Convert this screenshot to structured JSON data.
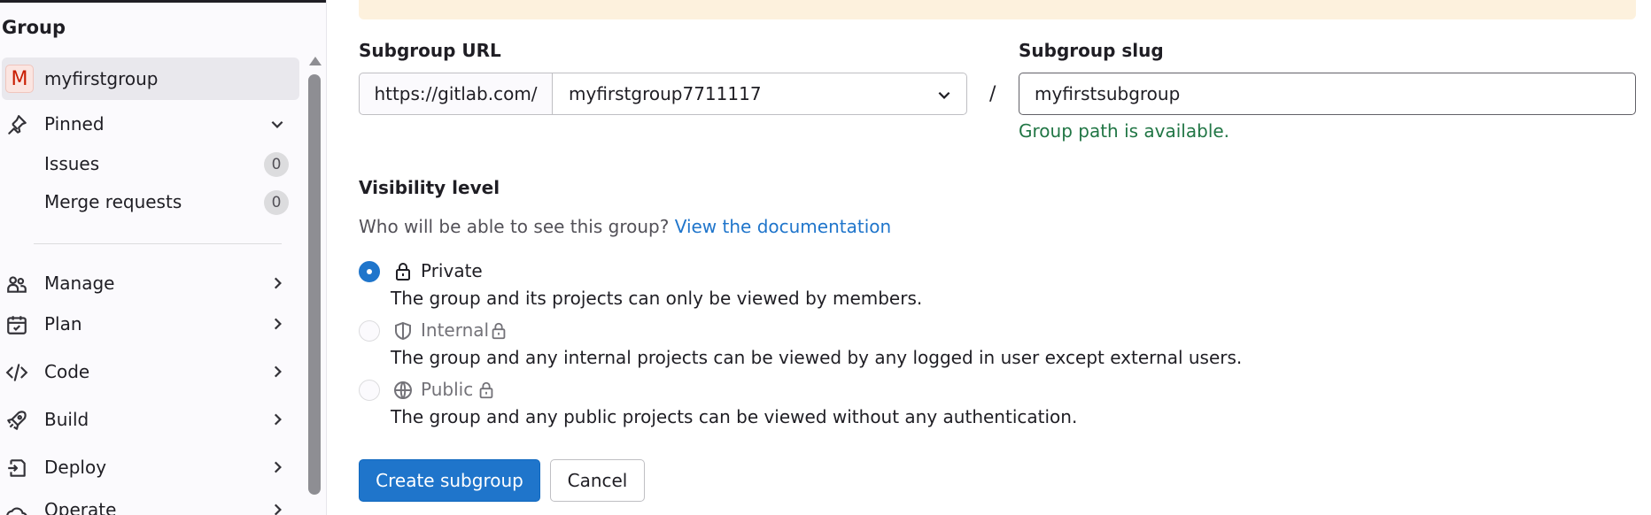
{
  "sidebar": {
    "title": "Group",
    "group": {
      "avatar_letter": "M",
      "name": "myfirstgroup"
    },
    "pinned": {
      "label": "Pinned",
      "items": [
        {
          "label": "Issues",
          "count": "0"
        },
        {
          "label": "Merge requests",
          "count": "0"
        }
      ]
    },
    "nav": [
      {
        "label": "Manage",
        "icon": "users-icon"
      },
      {
        "label": "Plan",
        "icon": "calendar-icon"
      },
      {
        "label": "Code",
        "icon": "code-icon"
      },
      {
        "label": "Build",
        "icon": "rocket-icon"
      },
      {
        "label": "Deploy",
        "icon": "deploy-icon"
      },
      {
        "label": "Operate",
        "icon": "cloud-icon"
      }
    ]
  },
  "form": {
    "url": {
      "label": "Subgroup URL",
      "prefix": "https://gitlab.com/",
      "selected_group": "myfirstgroup7711117"
    },
    "slug": {
      "label": "Subgroup slug",
      "value": "myfirstsubgroup",
      "status": "Group path is available."
    },
    "separator": "/",
    "visibility": {
      "label": "Visibility level",
      "help": "Who will be able to see this group?",
      "help_link": "View the documentation",
      "options": [
        {
          "label": "Private",
          "description": "The group and its projects can only be viewed by members.",
          "checked": true,
          "disabled": false
        },
        {
          "label": "Internal",
          "description": "The group and any internal projects can be viewed by any logged in user except external users.",
          "checked": false,
          "disabled": true
        },
        {
          "label": "Public",
          "description": "The group and any public projects can be viewed without any authentication.",
          "checked": false,
          "disabled": true
        }
      ]
    },
    "buttons": {
      "create": "Create subgroup",
      "cancel": "Cancel"
    }
  },
  "colors": {
    "primary": "#1f75cb",
    "success": "#217645",
    "alert_bg": "#fdf1dd"
  }
}
